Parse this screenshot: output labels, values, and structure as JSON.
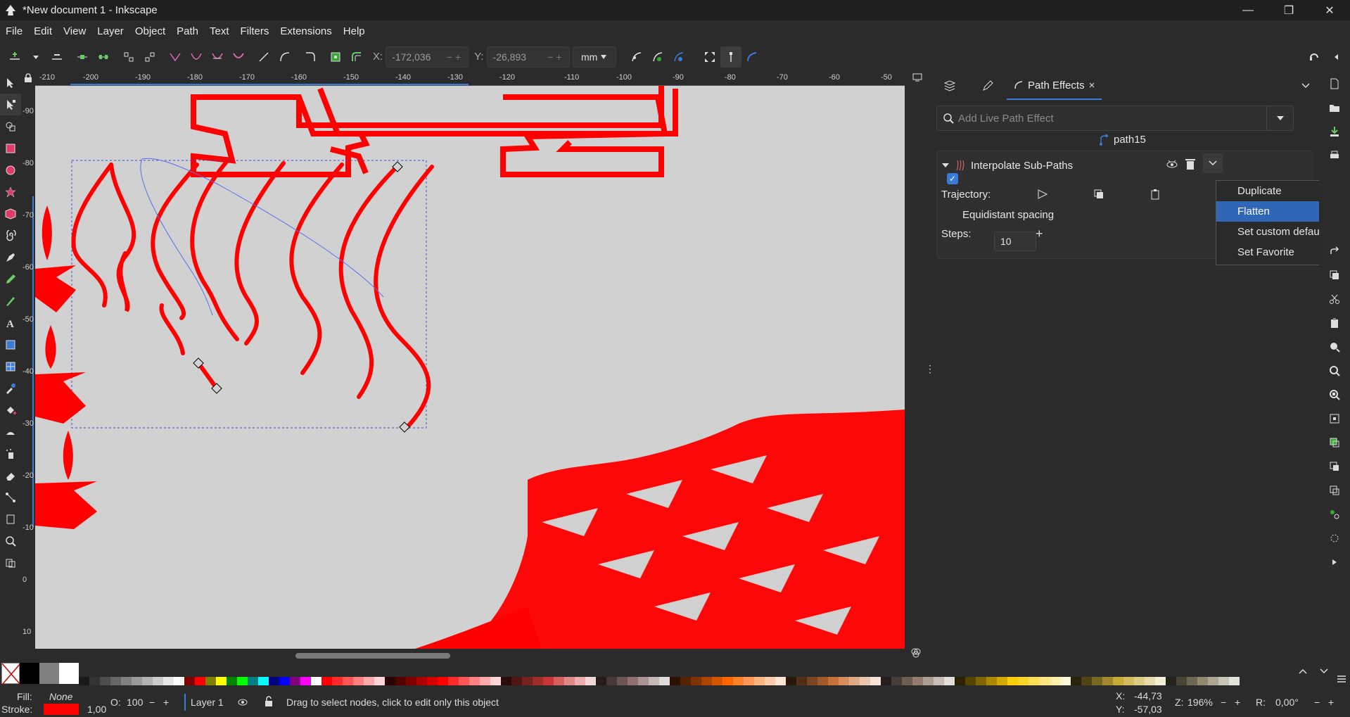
{
  "window": {
    "title": "*New document 1 - Inkscape",
    "minimize": "—",
    "maximize": "❐",
    "close": "✕"
  },
  "menu": [
    "File",
    "Edit",
    "View",
    "Layer",
    "Object",
    "Path",
    "Text",
    "Filters",
    "Extensions",
    "Help"
  ],
  "toolbar": {
    "x_label": "X:",
    "x_value": "-172,036",
    "y_label": "Y:",
    "y_value": "-26,893",
    "unit": "mm"
  },
  "ruler_top": [
    "-210",
    "-200",
    "-190",
    "-180",
    "-170",
    "-160",
    "-150",
    "-140",
    "-130",
    "-120",
    "-110",
    "-100",
    "-90",
    "-80",
    "-70",
    "-60",
    "-50"
  ],
  "ruler_left": [
    "-90",
    "-80",
    "-70",
    "-60",
    "-50",
    "-40",
    "-30",
    "-20",
    "-10",
    "0",
    "10"
  ],
  "panel": {
    "tab_label": "Path Effects",
    "tab_close": "×",
    "search_placeholder": "Add Live Path Effect",
    "path_name": "path15",
    "effect_name": "Interpolate Sub-Paths",
    "trajectory_label": "Trajectory:",
    "equidistant_label": "Equidistant spacing",
    "equidistant_checked": true,
    "steps_label": "Steps:",
    "steps_value": "10",
    "minus": "−",
    "plus": "+"
  },
  "context_menu": {
    "items": [
      "Duplicate",
      "Flatten",
      "Set custom defaults",
      "Set Favorite"
    ],
    "selected": "Flatten"
  },
  "status": {
    "fill_label": "Fill:",
    "fill_value": "None",
    "stroke_label": "Stroke:",
    "stroke_width": "1,00",
    "stroke_color": "#ff0000",
    "opacity_label": "O:",
    "opacity_value": "100",
    "layer_name": "Layer 1",
    "message": "Drag to select nodes, click to edit only this object",
    "cursor_x_label": "X:",
    "cursor_x": "-44,73",
    "cursor_y_label": "Y:",
    "cursor_y": "-57,03",
    "zoom_label": "Z:",
    "zoom_value": "196%",
    "rotation_label": "R:",
    "rotation_value": "0,00°"
  },
  "colors": {
    "accent": "#3a7bd5",
    "selection": "#2f66b5",
    "canvas_bg": "#d1d1d1",
    "path_red": "#ff0000"
  },
  "palette_colors": [
    "#ffffff",
    "#000000",
    "#808080",
    "#ffffff",
    "#1a1a1a",
    "#333333",
    "#4d4d4d",
    "#666666",
    "#808080",
    "#999999",
    "#b3b3b3",
    "#cccccc",
    "#e6e6e6",
    "#ffffff",
    "#800000",
    "#ff0000",
    "#808000",
    "#ffff00",
    "#008000",
    "#00ff00",
    "#008080",
    "#00ffff",
    "#000080",
    "#0000ff",
    "#800080",
    "#ff00ff",
    "#ffffff",
    "#ff0000",
    "#ff2a2a",
    "#ff5555",
    "#ff8080",
    "#ffaaaa",
    "#ffd5d5",
    "#2b0000",
    "#550000",
    "#800000",
    "#aa0000",
    "#d40000",
    "#ff0000",
    "#ff2a2a",
    "#ff5555",
    "#ff8080",
    "#ffaaaa",
    "#ffd5d5",
    "#280b0b",
    "#501616",
    "#782121",
    "#a02c2c",
    "#c83737",
    "#d35f5f",
    "#de8787",
    "#e9afaf",
    "#f4d7d7",
    "#241c1c",
    "#483737",
    "#6c5353",
    "#916f6f",
    "#ac9393",
    "#c8b7b7",
    "#e3dbdb",
    "#2b1100",
    "#552200",
    "#803300",
    "#aa4400",
    "#d45500",
    "#ff6600",
    "#ff7f2a",
    "#ff9955",
    "#ffb380",
    "#ffccaa",
    "#ffe6d5",
    "#28170b",
    "#502d16",
    "#784421",
    "#a05a2c",
    "#c87137",
    "#d38d5f",
    "#deaa87",
    "#e9c6af",
    "#f4e3d7",
    "#241f1c",
    "#483e37",
    "#6c5d53",
    "#917c6f",
    "#ac9d93",
    "#c8beb7",
    "#e3dedb",
    "#2b2200",
    "#554400",
    "#806600",
    "#aa8800",
    "#d4aa00",
    "#ffcc00",
    "#ffd42a",
    "#ffdd55",
    "#ffe680",
    "#ffeeaa",
    "#fff6d5",
    "#28220b",
    "#504416",
    "#786721",
    "#a0892c",
    "#c8ab37",
    "#d3bc5f",
    "#decd87",
    "#e9ddaf",
    "#f4eed7",
    "#24221c",
    "#484537",
    "#6c6753",
    "#918a6f",
    "#aca793",
    "#c8c4b7",
    "#e3e2db"
  ]
}
